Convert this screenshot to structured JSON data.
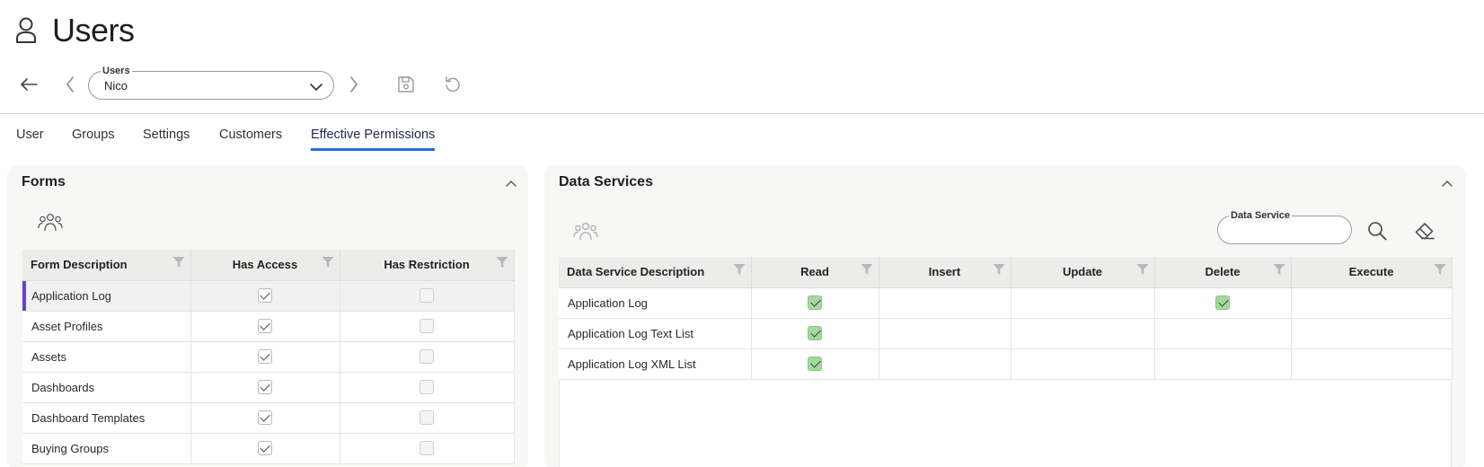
{
  "page": {
    "title": "Users"
  },
  "toolbar": {
    "user_select": {
      "label": "Users",
      "value": "Nico"
    }
  },
  "tabs": [
    {
      "label": "User"
    },
    {
      "label": "Groups"
    },
    {
      "label": "Settings"
    },
    {
      "label": "Customers"
    },
    {
      "label": "Effective Permissions",
      "active": true
    }
  ],
  "forms_panel": {
    "title": "Forms",
    "columns": [
      "Form Description",
      "Has Access",
      "Has Restriction"
    ],
    "rows": [
      {
        "description": "Application Log",
        "has_access": true,
        "has_restriction": false,
        "selected": true
      },
      {
        "description": "Asset Profiles",
        "has_access": true,
        "has_restriction": false
      },
      {
        "description": "Assets",
        "has_access": true,
        "has_restriction": false
      },
      {
        "description": "Dashboards",
        "has_access": true,
        "has_restriction": false
      },
      {
        "description": "Dashboard Templates",
        "has_access": true,
        "has_restriction": false
      },
      {
        "description": "Buying Groups",
        "has_access": true,
        "has_restriction": false
      }
    ]
  },
  "ds_panel": {
    "title": "Data Services",
    "search": {
      "label": "Data Service",
      "value": ""
    },
    "columns": [
      "Data Service Description",
      "Read",
      "Insert",
      "Update",
      "Delete",
      "Execute"
    ],
    "rows": [
      {
        "description": "Application Log",
        "read": true,
        "insert": false,
        "update": false,
        "delete": true,
        "execute": false
      },
      {
        "description": "Application Log Text List",
        "read": true,
        "insert": false,
        "update": false,
        "delete": false,
        "execute": false
      },
      {
        "description": "Application Log XML List",
        "read": true,
        "insert": false,
        "update": false,
        "delete": false,
        "execute": false
      }
    ]
  },
  "colors": {
    "accent": "#1f6fe0",
    "selection": "#6b3fd1",
    "check_green": "#a5d79e"
  }
}
